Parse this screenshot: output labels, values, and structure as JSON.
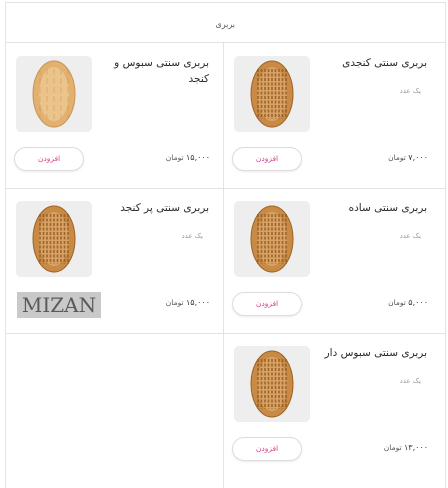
{
  "header": {
    "title": "بربری"
  },
  "products": [
    {
      "name": "بربری سنتی کنجدی",
      "unit": "یک عدد",
      "price": "۷,۰۰۰",
      "currency": "تومان",
      "button": "افزودن",
      "image": "bread-icon"
    },
    {
      "name": "بربری سنتی سبوس و کنجد",
      "unit": "",
      "price": "۱۵,۰۰۰",
      "currency": "تومان",
      "button": "افزودن",
      "image": "bread-icon"
    },
    {
      "name": "بربری سنتی ساده",
      "unit": "یک عدد",
      "price": "۵,۰۰۰",
      "currency": "تومان",
      "button": "افزودن",
      "image": "bread-icon"
    },
    {
      "name": "بربری سنتی پر کنجد",
      "unit": "یک عدد",
      "price": "۱۵,۰۰۰",
      "currency": "تومان",
      "button": "",
      "image": "bread-icon"
    },
    {
      "name": "بربری سنتی سبوس دار",
      "unit": "یک عدد",
      "price": "۱۳,۰۰۰",
      "currency": "تومان",
      "button": "افزودن",
      "image": "bread-icon"
    }
  ],
  "watermark": "MIZAN"
}
